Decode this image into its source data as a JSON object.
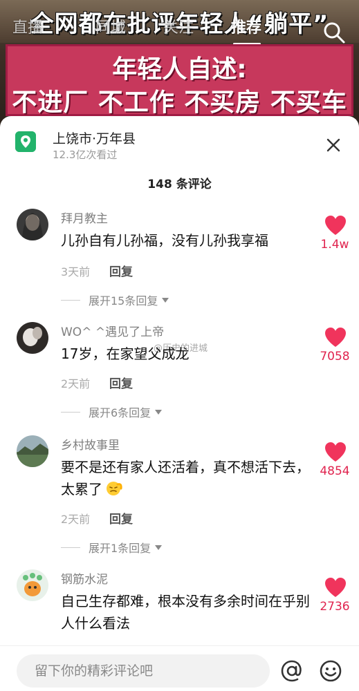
{
  "video": {
    "headline": "全网都在批评年轻人“躺平”",
    "banner_line1": "年轻人自述:",
    "banner_line2": "不进厂 不工作 不买房 不买车"
  },
  "top_nav": {
    "tabs": [
      {
        "label": "直播"
      },
      {
        "label": "同城"
      },
      {
        "label": "关注"
      },
      {
        "label": "推荐",
        "active": true
      }
    ],
    "search_icon": "search-icon"
  },
  "location": {
    "name": "上饶市·万年县",
    "views": "12.3亿次看过",
    "icon": "location-pin-icon",
    "icon_color": "#22b36b"
  },
  "comment_count": "148 条评论",
  "comments": [
    {
      "user": "拜月教主",
      "text": "儿孙自有儿孙福，没有儿孙我享福",
      "time": "3天前",
      "reply": "回复",
      "expand": "展开15条回复",
      "likes": "1.4w"
    },
    {
      "user": "WO^ ^遇见了上帝",
      "text": "17岁，在家望父成龙",
      "time": "2天前",
      "reply": "回复",
      "expand": "展开6条回复",
      "likes": "7058"
    },
    {
      "user": "乡村故事里",
      "text": "要不是还有家人还活着，真不想活下去，太累了",
      "time": "2天前",
      "reply": "回复",
      "expand": "展开1条回复",
      "likes": "4854"
    },
    {
      "user": "钢筋水泥",
      "text": "自己生存都难，根本没有多余时间在乎别人什么看法",
      "likes": "2736"
    }
  ],
  "watermark": "@历史的进城",
  "input": {
    "placeholder": "留下你的精彩评论吧",
    "at_icon": "at-icon",
    "emoji_icon": "emoji-icon"
  },
  "colors": {
    "like": "#e0234e",
    "banner": "#c7385c"
  }
}
